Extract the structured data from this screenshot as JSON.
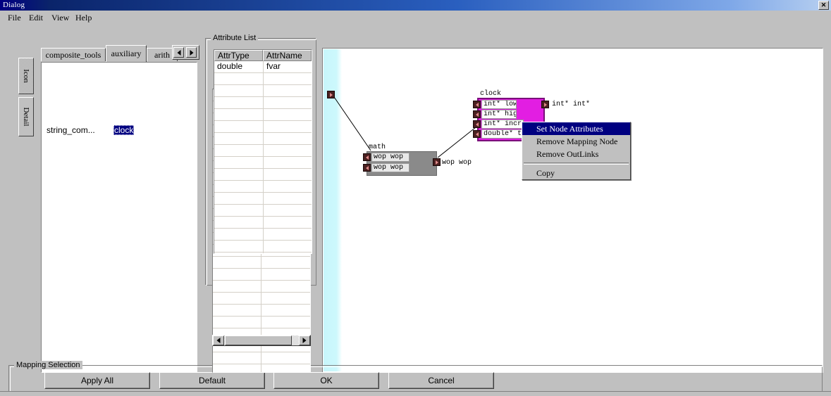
{
  "window": {
    "title": "Dialog",
    "close_label": "✕"
  },
  "menubar": {
    "items": [
      {
        "label": "File"
      },
      {
        "label": "Edit"
      },
      {
        "label": "View"
      },
      {
        "label": "Help"
      }
    ]
  },
  "side_tabs": {
    "items": [
      {
        "label": "Icon",
        "selected": true
      },
      {
        "label": "Detail",
        "selected": false
      }
    ]
  },
  "palette": {
    "tabs": [
      {
        "label": "composite_tools",
        "selected": false
      },
      {
        "label": "auxiliary",
        "selected": true
      },
      {
        "label": "arith",
        "selected": false
      }
    ],
    "scroll_left": "◄",
    "scroll_right": "►",
    "items": [
      {
        "label": "string_com...",
        "selected": false
      },
      {
        "label": "clock",
        "selected": true
      }
    ]
  },
  "attribute_list": {
    "title": "Attribute List",
    "columns": [
      "AttrType",
      "AttrName"
    ],
    "rows": [
      [
        "double",
        "fvar"
      ]
    ],
    "scroll_left": "◄",
    "scroll_right": "►"
  },
  "canvas": {
    "source_port": {
      "name": "canvas-source-port"
    },
    "nodes": [
      {
        "id": "math",
        "label": "math",
        "color": "#8a8a8a",
        "inputs": [
          "wop wop",
          "wop wop"
        ],
        "outputs": [
          "wop wop"
        ]
      },
      {
        "id": "clock",
        "label": "clock",
        "color": "#e21ee2",
        "inputs": [
          "int* low",
          "int* high",
          "int* increm",
          "double* tim"
        ],
        "outputs": [
          "int* int*"
        ]
      }
    ]
  },
  "context_menu": {
    "items": [
      {
        "label": "Set Node Attributes",
        "highlighted": true,
        "separator_after": false
      },
      {
        "label": "Remove Mapping Node",
        "highlighted": false,
        "separator_after": false
      },
      {
        "label": "Remove OutLinks",
        "highlighted": false,
        "separator_after": true
      },
      {
        "label": "Copy",
        "highlighted": false,
        "separator_after": false
      }
    ]
  },
  "footer": {
    "title": "Mapping Selection",
    "buttons": [
      {
        "label": "Apply All"
      },
      {
        "label": "Default"
      },
      {
        "label": "OK"
      },
      {
        "label": "Cancel"
      }
    ]
  }
}
